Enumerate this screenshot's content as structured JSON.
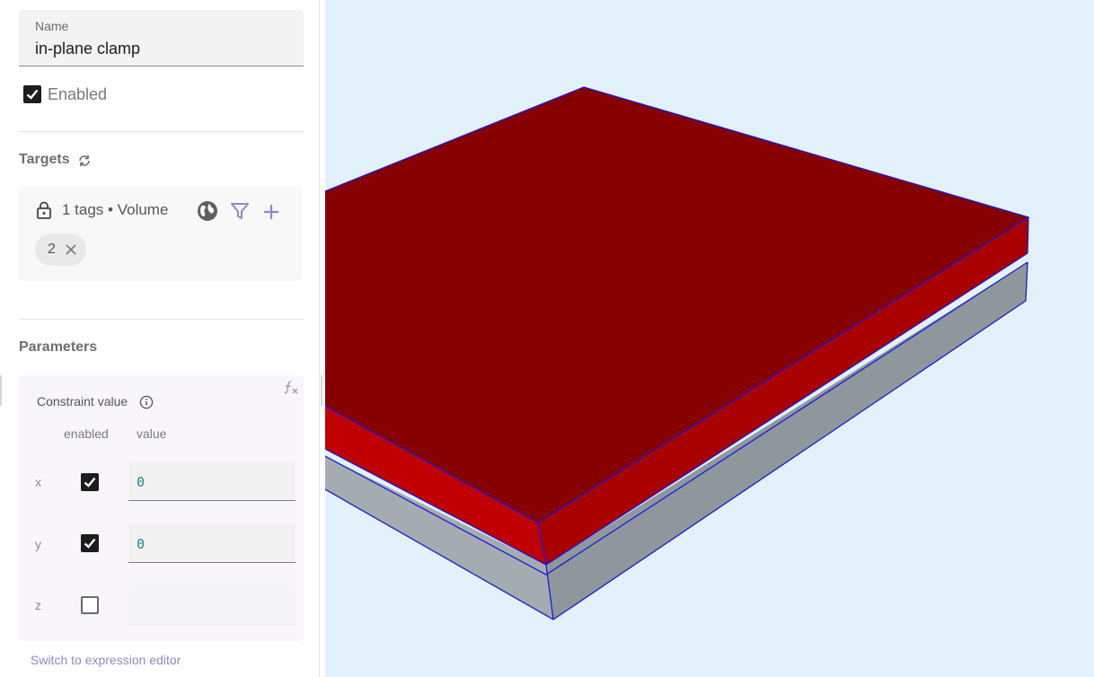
{
  "form": {
    "name_label": "Name",
    "name_value": "in-plane clamp",
    "enabled_label": "Enabled",
    "enabled": true
  },
  "targets": {
    "title": "Targets",
    "summary": "1 tags • Volume",
    "chips": [
      "2"
    ]
  },
  "parameters": {
    "title": "Parameters",
    "constraint_label": "Constraint value",
    "col_enabled": "enabled",
    "col_value": "value",
    "rows": [
      {
        "label": "x",
        "enabled": true,
        "value": "0"
      },
      {
        "label": "y",
        "enabled": true,
        "value": "0"
      },
      {
        "label": "z",
        "enabled": false,
        "value": ""
      }
    ]
  },
  "footer": {
    "switch_link": "Switch to expression editor"
  },
  "viewport": {
    "background": "#e3f1fd",
    "top_color": "#870000",
    "side_color": "#c00000",
    "base_color": "#a5acb1",
    "edge_color": "#1a1ad6"
  }
}
